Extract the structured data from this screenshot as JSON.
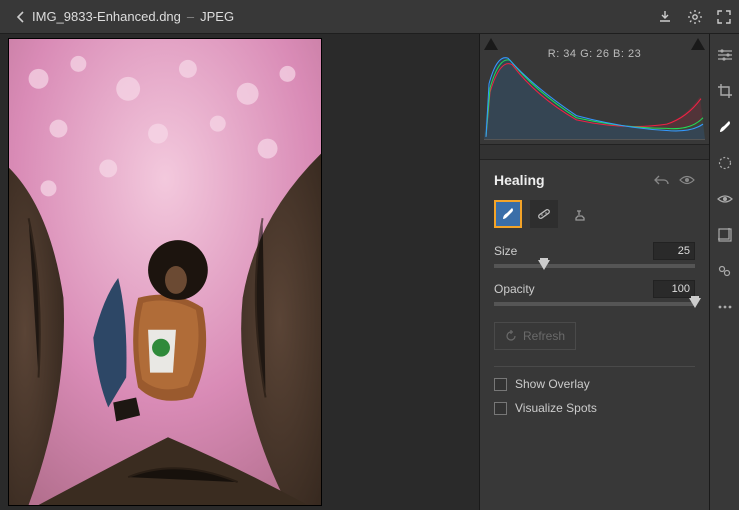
{
  "topbar": {
    "filename": "IMG_9833-Enhanced.dng",
    "separator": "–",
    "format": "JPEG"
  },
  "histogram": {
    "readout": "R: 34   G: 26   B: 23",
    "r": 34,
    "g": 26,
    "b": 23
  },
  "panel": {
    "title": "Healing",
    "tools": {
      "healing": "healing-brush",
      "clone": "clone-stamp",
      "stamp": "rubber-stamp"
    },
    "size": {
      "label": "Size",
      "value": "25",
      "percent": 25
    },
    "opacity": {
      "label": "Opacity",
      "value": "100",
      "percent": 100
    },
    "refresh": "Refresh",
    "show_overlay": "Show Overlay",
    "visualize_spots": "Visualize Spots"
  },
  "right_rail": {
    "sliders": "adjust-panel",
    "crop": "crop-tool",
    "healing": "healing-tool",
    "mask": "mask-tool",
    "redeye": "redeye-tool",
    "presets": "presets",
    "snapshots": "snapshots",
    "more": "more"
  }
}
